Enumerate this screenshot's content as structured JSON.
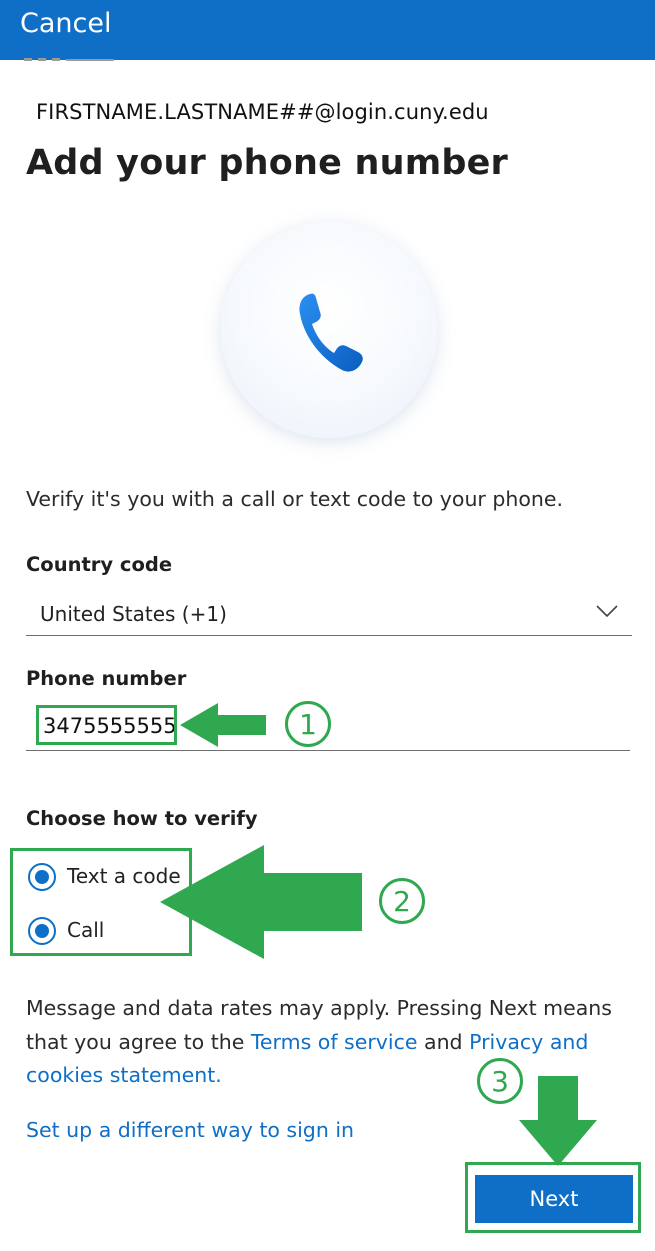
{
  "header": {
    "cancel_label": "Cancel"
  },
  "account": {
    "email": "FIRSTNAME.LASTNAME##@login.cuny.edu"
  },
  "page": {
    "title": "Add your phone number",
    "description": "Verify it's you with a call or text code to your phone."
  },
  "country": {
    "label": "Country code",
    "selected": "United States (+1)"
  },
  "phone": {
    "label": "Phone number",
    "value": "3475555555"
  },
  "verify": {
    "label": "Choose how to verify",
    "options": [
      {
        "label": "Text a code"
      },
      {
        "label": "Call"
      }
    ]
  },
  "legal": {
    "prefix": "Message and data rates may apply. Pressing Next means that you agree to the ",
    "terms_link": "Terms of service",
    "and_text": " and ",
    "privacy_link": "Privacy and cookies statement."
  },
  "alt_signin_link": "Set up a different way to sign in",
  "next_label": "Next",
  "annotations": {
    "step1": "1",
    "step2": "2",
    "step3": "3",
    "color": "#2fa84f"
  },
  "colors": {
    "accent": "#0f6fc6"
  }
}
